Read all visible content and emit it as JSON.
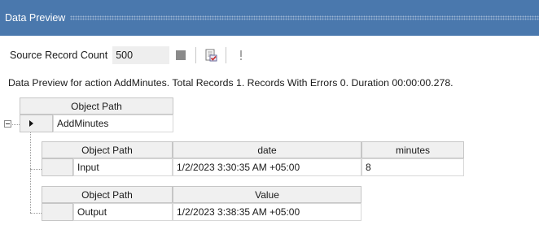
{
  "panel": {
    "title": "Data Preview"
  },
  "toolbar": {
    "source_record_count_label": "Source Record Count",
    "source_record_count_value": "500",
    "icons": [
      "stop-icon",
      "checklist-icon",
      "exclamation-icon"
    ]
  },
  "info_text": "Data Preview for action AddMinutes. Total Records 1. Records With Errors 0. Duration 00:00:00.278.",
  "grid": {
    "root": {
      "header": "Object Path",
      "row": "AddMinutes"
    },
    "input_table": {
      "headers": [
        "Object Path",
        "date",
        "minutes"
      ],
      "row": [
        "Input",
        "1/2/2023 3:30:35 AM +05:00",
        "8"
      ]
    },
    "output_table": {
      "headers": [
        "Object Path",
        "Value"
      ],
      "row": [
        "Output",
        "1/2/2023 3:38:35 AM +05:00"
      ]
    }
  }
}
